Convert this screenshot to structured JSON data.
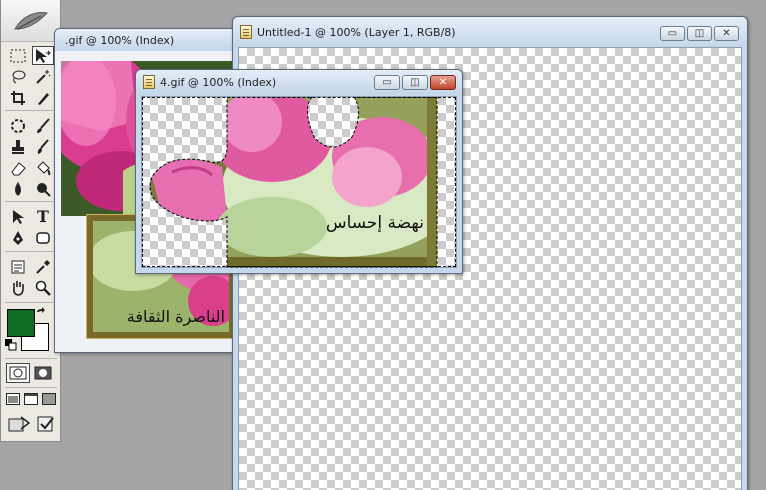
{
  "windows": {
    "back_gif": {
      "title": ".gif @ 100% (Index)",
      "caption": "الناصرة الثقافة"
    },
    "untitled": {
      "title": "Untitled-1 @ 100% (Layer 1, RGB/8)"
    },
    "front_gif": {
      "title": "4.gif @ 100% (Index)",
      "caption": "نهضة إحساس"
    }
  },
  "window_controls": {
    "minimize": "▭",
    "restore": "◫",
    "close": "✕"
  },
  "colors": {
    "foreground": "#0f6b1f",
    "background": "#ffffff",
    "titlebar": "#c3d6ea",
    "close_button": "#c1442b"
  },
  "toolbox": {
    "tools": [
      "marquee-tool",
      "move-tool",
      "lasso-tool",
      "magic-wand-tool",
      "crop-tool",
      "slice-tool",
      "healing-brush-tool",
      "brush-tool",
      "clone-stamp-tool",
      "history-brush-tool",
      "eraser-tool",
      "paint-bucket-tool",
      "blur-tool",
      "dodge-tool",
      "path-selection-tool",
      "type-tool",
      "pen-tool",
      "shape-tool",
      "notes-tool",
      "eyedropper-tool",
      "hand-tool",
      "zoom-tool"
    ],
    "type_tool_label": "T"
  }
}
